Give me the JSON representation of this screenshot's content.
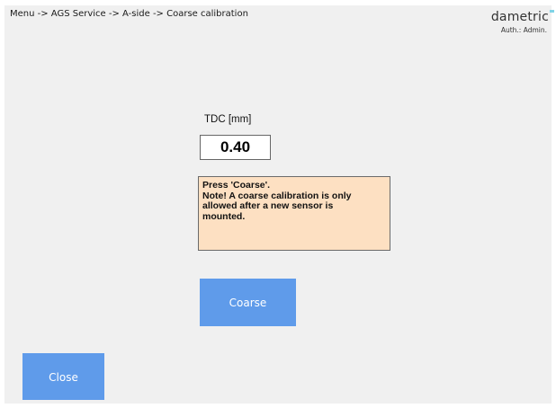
{
  "header": {
    "breadcrumb": "Menu -> AGS Service -> A-side -> Coarse calibration",
    "logo_text": "dametric",
    "auth": "Auth.: Admin."
  },
  "main": {
    "tdc_label": "TDC [mm]",
    "tdc_value": "0.40",
    "message_lines": [
      "Press 'Coarse'.",
      "Note! A coarse calibration is only",
      "allowed after a new sensor is",
      "mounted."
    ],
    "coarse_label": "Coarse",
    "close_label": "Close"
  },
  "colors": {
    "panel_background": "#f0f0f0",
    "button_blue": "#5f9bea",
    "message_background": "#fde0c2",
    "logo_accent": "#7fd3e6"
  }
}
